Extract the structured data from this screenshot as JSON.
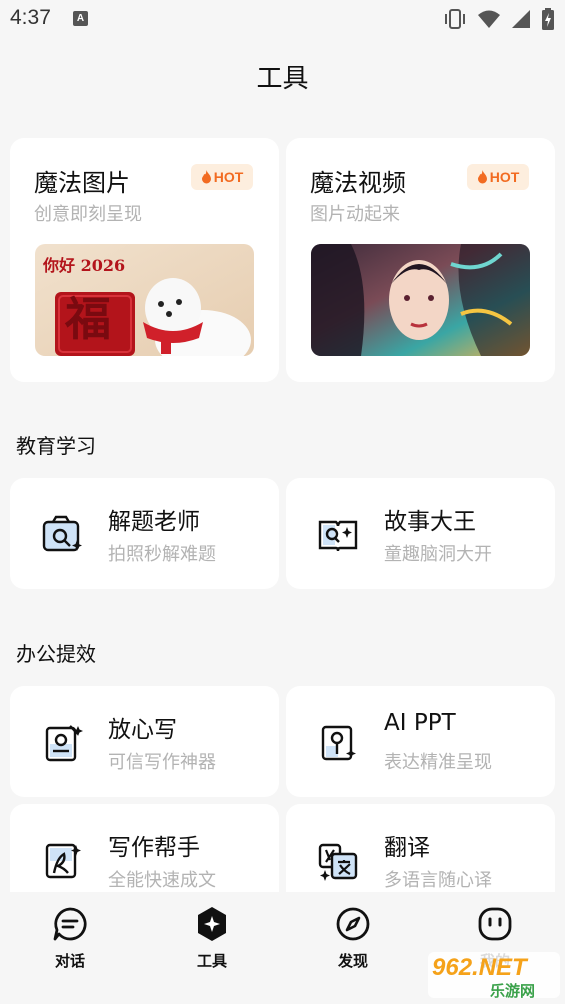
{
  "status_bar": {
    "time": "4:37",
    "notification_badge": "A"
  },
  "header": {
    "title": "工具"
  },
  "featured": [
    {
      "title": "魔法图片",
      "subtitle": "创意即刻呈现",
      "badge": "HOT",
      "image_text": "你好 2026",
      "image_char": "福"
    },
    {
      "title": "魔法视频",
      "subtitle": "图片动起来",
      "badge": "HOT"
    }
  ],
  "sections": [
    {
      "title": "教育学习",
      "tools": [
        {
          "title": "解题老师",
          "subtitle": "拍照秒解难题",
          "icon": "camera-sparkle-icon"
        },
        {
          "title": "故事大王",
          "subtitle": "童趣脑洞大开",
          "icon": "storybook-sparkle-icon"
        }
      ]
    },
    {
      "title": "办公提效",
      "tools": [
        {
          "title": "放心写",
          "subtitle": "可信写作神器",
          "icon": "safe-write-icon"
        },
        {
          "title": "AI PPT",
          "subtitle": "表达精准呈现",
          "icon": "ppt-icon"
        },
        {
          "title": "写作帮手",
          "subtitle": "全能快速成文",
          "icon": "writing-helper-icon"
        },
        {
          "title": "翻译",
          "subtitle": "多语言随心译",
          "icon": "translate-icon"
        }
      ]
    }
  ],
  "tab_bar": [
    {
      "label": "对话",
      "icon": "chat-icon"
    },
    {
      "label": "工具",
      "icon": "tools-icon",
      "active": true
    },
    {
      "label": "发现",
      "icon": "compass-icon"
    },
    {
      "label": "我的",
      "icon": "profile-icon"
    }
  ],
  "watermark": {
    "text": "962.NET",
    "sub": "乐游网"
  },
  "colors": {
    "background": "#f6f6f6",
    "card": "#ffffff",
    "hot": "#f26b21",
    "hot_bg": "#fdeede",
    "muted": "#b3b3b3",
    "icon_fill": "#cfe3f7"
  }
}
